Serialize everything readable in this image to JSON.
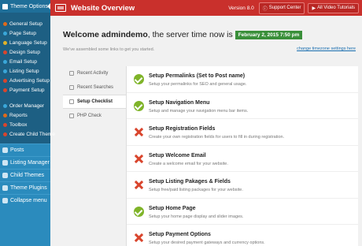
{
  "sidebar": {
    "header": "Theme Options",
    "sub_items": [
      {
        "label": "General Setup",
        "color": "#e06a1a"
      },
      {
        "label": "Page Setup",
        "color": "#3aa7d9"
      },
      {
        "label": "Language Setup",
        "color": "#e0b22a"
      },
      {
        "label": "Design Setup",
        "color": "#d9452d"
      },
      {
        "label": "Email Setup",
        "color": "#3aa7d9"
      },
      {
        "label": "Listing Setup",
        "color": "#3aa7d9"
      },
      {
        "label": "Advertising Setup",
        "color": "#d9452d"
      },
      {
        "label": "Payment Setup",
        "color": "#d9452d"
      }
    ],
    "sub_items2": [
      {
        "label": "Order Manager",
        "color": "#3aa7d9"
      },
      {
        "label": "Reports",
        "color": "#e06a1a"
      },
      {
        "label": "Toolbox",
        "color": "#d9452d"
      },
      {
        "label": "Create Child Theme",
        "color": "#d9452d"
      }
    ],
    "main_items": [
      "Posts",
      "Listing Manager",
      "Child Themes",
      "Theme Plugins",
      "Collapse menu"
    ]
  },
  "header": {
    "title": "Website Overview",
    "version": "Version 8.0",
    "support_label": "Support Center",
    "tutorials_label": "All Video Tutorials"
  },
  "welcome": {
    "greeting": "Welcome admindemo",
    "server_text": ", the server time now is",
    "date": "February 2, 2015 7:50 pm",
    "subtitle": "We've assembled some links to get you started.",
    "timezone_link": "change timezone settings here"
  },
  "tabs": [
    "Recent Activity",
    "Recent Searches",
    "Setup Checklist",
    "PHP Check"
  ],
  "active_tab": "Setup Checklist",
  "checklist": [
    {
      "title": "Setup Permalinks (Set to Post name)",
      "desc": "Setup your permalinks for SEO and general usage.",
      "done": true
    },
    {
      "title": "Setup Navigation Menu",
      "desc": "Setup and manage your navigation menu bar items.",
      "done": true
    },
    {
      "title": "Setup Registration Fields",
      "desc": "Create your own registration fields for users to fill in during registration.",
      "done": false
    },
    {
      "title": "Setup Welcome Email",
      "desc": "Create a welcome email for your website.",
      "done": false
    },
    {
      "title": "Setup Listing Pakages & Fields",
      "desc": "Setup free/paid listing packages for your website.",
      "done": false
    },
    {
      "title": "Setup Home Page",
      "desc": "Setup your home page display and slider images.",
      "done": true
    },
    {
      "title": "Setup Payment Options",
      "desc": "Setup your desired payment gateways and currency options.",
      "done": false
    }
  ]
}
